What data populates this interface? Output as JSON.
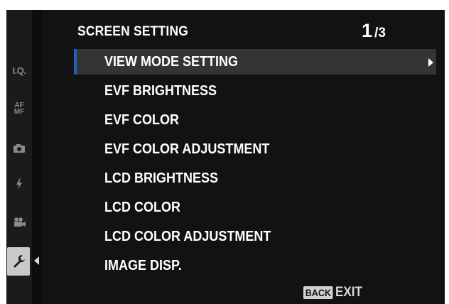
{
  "header": {
    "title": "SCREEN SETTING",
    "page_current": "1",
    "page_separator": "/",
    "page_total": "3"
  },
  "tabs": [
    {
      "label": "I.Q.",
      "icon": "image-quality-icon"
    },
    {
      "label": "AF MF",
      "icon": "af-mf-icon"
    },
    {
      "label": "",
      "icon": "camera-icon"
    },
    {
      "label": "",
      "icon": "flash-icon"
    },
    {
      "label": "",
      "icon": "movie-icon"
    },
    {
      "label": "",
      "icon": "wrench-setup-icon",
      "active": true
    }
  ],
  "tab_labels": {
    "iq": "I.Q.",
    "af": "AF",
    "mf": "MF"
  },
  "menu": {
    "items": [
      {
        "label": "VIEW MODE SETTING"
      },
      {
        "label": "EVF BRIGHTNESS"
      },
      {
        "label": "EVF COLOR"
      },
      {
        "label": "EVF COLOR ADJUSTMENT"
      },
      {
        "label": "LCD BRIGHTNESS"
      },
      {
        "label": "LCD COLOR"
      },
      {
        "label": "LCD COLOR ADJUSTMENT"
      },
      {
        "label": "IMAGE DISP."
      }
    ],
    "selected_index": 0
  },
  "footer": {
    "back_key": "BACK",
    "exit_label": "EXIT"
  },
  "colors": {
    "background": "#121212",
    "selection": "#343434",
    "selection_marker": "#1f5fbf",
    "text": "#ffffff"
  }
}
